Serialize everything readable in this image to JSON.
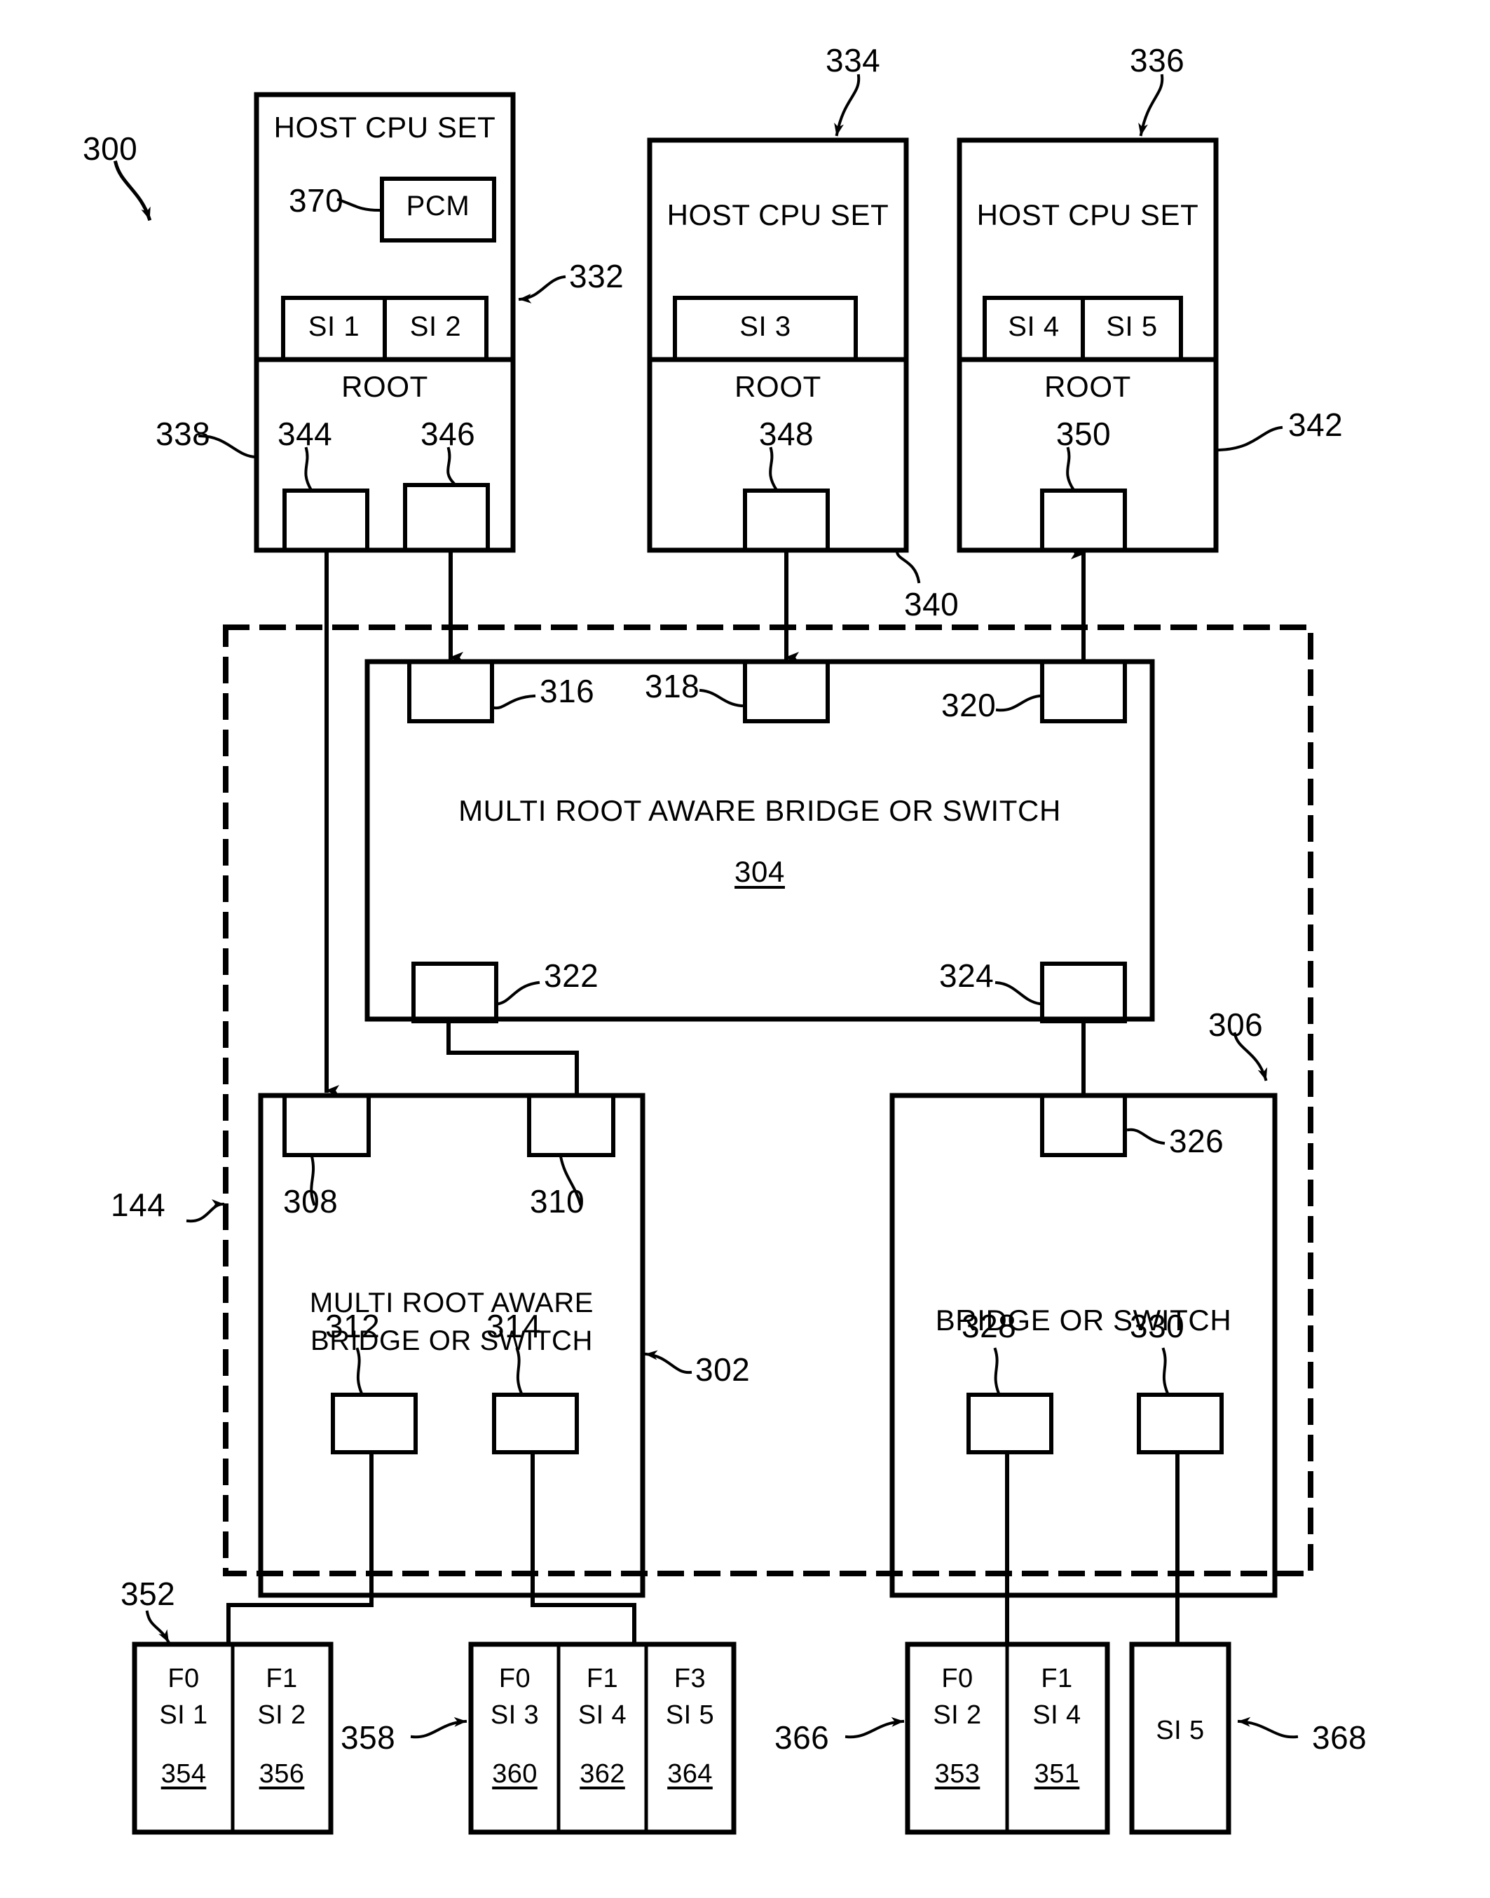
{
  "figure": {
    "ref_300": "300",
    "ref_144": "144"
  },
  "hosts": [
    {
      "id": "host1",
      "title": "HOST CPU SET",
      "ref_box": "332",
      "pcm_label": "PCM",
      "pcm_ref": "370",
      "si": [
        "SI 1",
        "SI 2"
      ],
      "root_label": "ROOT",
      "root_ref": "338",
      "ports": [
        {
          "ref": "344"
        },
        {
          "ref": "346"
        }
      ]
    },
    {
      "id": "host2",
      "title": "HOST CPU SET",
      "ref_box": "334",
      "si": [
        "SI 3"
      ],
      "root_label": "ROOT",
      "root_ref": "340",
      "ports": [
        {
          "ref": "348"
        }
      ]
    },
    {
      "id": "host3",
      "title": "HOST CPU SET",
      "ref_box": "336",
      "si": [
        "SI 4",
        "SI 5"
      ],
      "root_label": "ROOT",
      "root_ref": "342",
      "ports": [
        {
          "ref": "350"
        }
      ]
    }
  ],
  "switches": [
    {
      "id": "switch304",
      "title": "MULTI ROOT AWARE BRIDGE OR SWITCH",
      "ref": "304",
      "upstream_ports": [
        "316",
        "318",
        "320"
      ],
      "downstream_ports": [
        "322",
        "324"
      ]
    },
    {
      "id": "switch302",
      "title_line1": "MULTI ROOT AWARE",
      "title_line2": "BRIDGE OR SWITCH",
      "ref": "302",
      "upstream_ports": [
        "308",
        "310"
      ],
      "downstream_ports": [
        "312",
        "314"
      ]
    },
    {
      "id": "switch306",
      "title": "BRIDGE OR SWITCH",
      "ref": "306",
      "upstream_ports": [
        "326"
      ],
      "downstream_ports": [
        "328",
        "330"
      ]
    }
  ],
  "endpoints": [
    {
      "id": "ep352",
      "ref": "352",
      "ref_side": "left",
      "functions": [
        {
          "fn": "F0",
          "si": "SI 1",
          "num": "354"
        },
        {
          "fn": "F1",
          "si": "SI 2",
          "num": "356"
        }
      ]
    },
    {
      "id": "ep358",
      "ref": "358",
      "ref_side": "left",
      "functions": [
        {
          "fn": "F0",
          "si": "SI 3",
          "num": "360"
        },
        {
          "fn": "F1",
          "si": "SI 4",
          "num": "362"
        },
        {
          "fn": "F3",
          "si": "SI 5",
          "num": "364"
        }
      ]
    },
    {
      "id": "ep366",
      "ref": "366",
      "ref_side": "left",
      "functions": [
        {
          "fn": "F0",
          "si": "SI 2",
          "num": "353"
        },
        {
          "fn": "F1",
          "si": "SI 4",
          "num": "351"
        }
      ]
    },
    {
      "id": "ep368",
      "ref": "368",
      "ref_side": "right",
      "functions": [
        {
          "fn": "",
          "si": "SI 5",
          "num": ""
        }
      ]
    }
  ],
  "colors": {
    "ink": "#000000",
    "paper": "#ffffff"
  }
}
